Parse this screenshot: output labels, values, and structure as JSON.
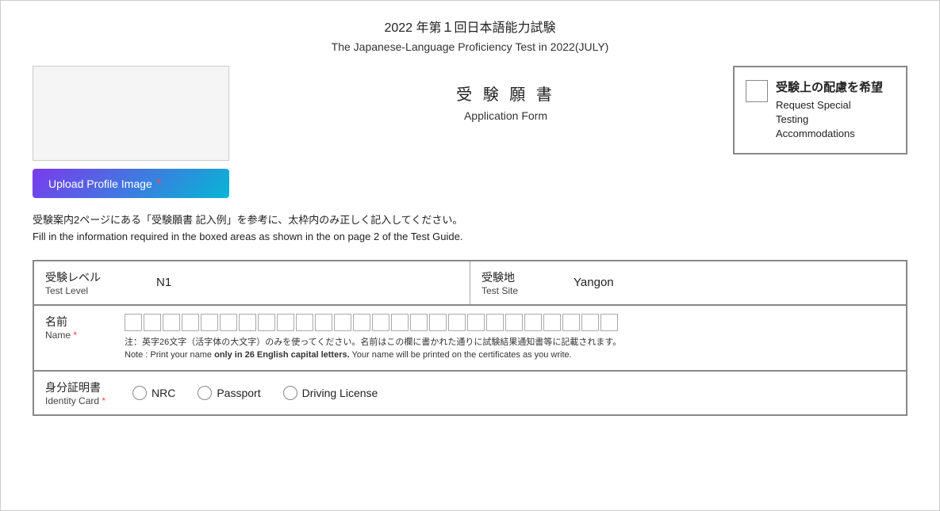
{
  "header": {
    "title_jp": "2022 年第１回日本語能力試験",
    "title_en": "The Japanese-Language Proficiency Test in 2022(JULY)"
  },
  "app_form": {
    "jp": "受 験 願 書",
    "en": "Application Form"
  },
  "upload_button": {
    "label": "Upload Profile Image",
    "required_marker": "*"
  },
  "accommodations": {
    "jp": "受験上の配慮を希望",
    "en_line1": "Request Special",
    "en_line2": "Testing",
    "en_line3": "Accommodations"
  },
  "instructions": {
    "line1": "受験案内2ページにある「受験願書 記入例」を参考に、太枠内のみ正しく記入してください。",
    "line2": "Fill in the information required in the boxed areas as shown in the on page 2 of the Test Guide."
  },
  "form": {
    "test_level_label_jp": "受験レベル",
    "test_level_label_en": "Test Level",
    "test_level_value": "N1",
    "test_site_label_jp": "受験地",
    "test_site_label_en": "Test Site",
    "test_site_value": "Yangon",
    "name_label_jp": "名前",
    "name_label_en": "Name",
    "name_required": "*",
    "name_char_count": 26,
    "name_note_line1": "注：英字26文字（活字体の大文字）のみを使ってください。名前はこの欄に書かれた通りに試験結果通知書等に記載されます。",
    "name_note_line2_prefix": "Note : Print your name ",
    "name_note_bold": "only in 26 English capital letters.",
    "name_note_line2_suffix": " Your name will be printed on the certificates as you write.",
    "id_card_label_jp": "身分証明書",
    "id_card_label_en": "Identity Card",
    "id_card_required": "*",
    "id_options": [
      "NRC",
      "Passport",
      "Driving License"
    ]
  }
}
